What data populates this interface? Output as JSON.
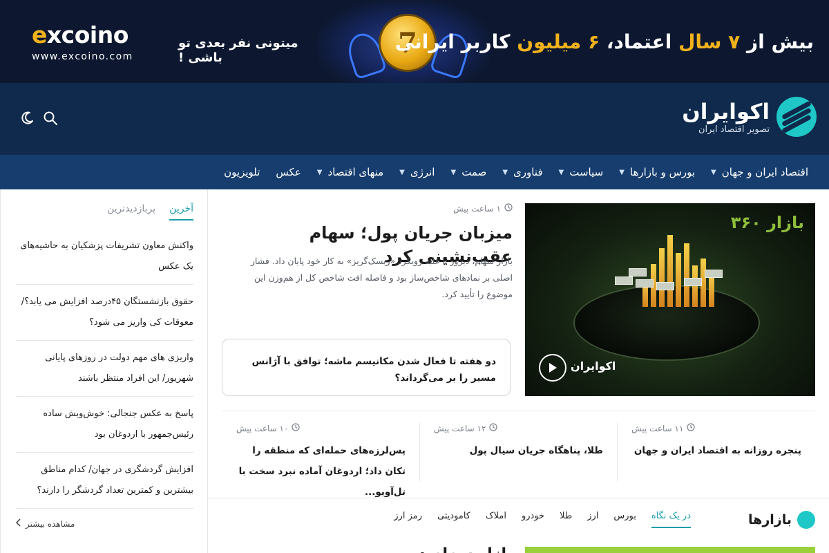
{
  "banner": {
    "brand_prefix": "e",
    "brand_rest": "xcoino",
    "url": "www.excoino.com",
    "subline": "میتونی نفر بعدی تو باشی !",
    "coin_value": "7",
    "headline_pre": "بیش از ",
    "headline_num1": "۷ سال",
    "headline_mid": " اعتماد، ",
    "headline_num2": "۶ میلیون",
    "headline_post": " کاربر ایرانی"
  },
  "header": {
    "site_name": "اکوایران",
    "site_tagline": "تصویر اقتصاد ایران",
    "search_icon": "search-icon",
    "theme_icon": "moon-icon"
  },
  "nav": {
    "items": [
      {
        "label": "اقتصاد ایران و جهان",
        "has_dropdown": true
      },
      {
        "label": "بورس و بازارها",
        "has_dropdown": true
      },
      {
        "label": "سیاست",
        "has_dropdown": true
      },
      {
        "label": "فناوری",
        "has_dropdown": true
      },
      {
        "label": "صمت",
        "has_dropdown": true
      },
      {
        "label": "انرژی",
        "has_dropdown": true
      },
      {
        "label": "منهای اقتصاد",
        "has_dropdown": true
      },
      {
        "label": "عکس",
        "has_dropdown": false
      },
      {
        "label": "تلویزیون",
        "has_dropdown": false
      }
    ]
  },
  "sidebar": {
    "tabs": [
      {
        "label": "آخرین",
        "active": true
      },
      {
        "label": "پربازدیدترین",
        "active": false
      }
    ],
    "items": [
      {
        "title": "واکنش معاون تشریفات پزشکیان به حاشیه‌های یک عکس"
      },
      {
        "title": "حقوق بازنشستگان ۴۵درصد افزایش می یابد؟/ معوقات کی واریز می شود؟"
      },
      {
        "title": "واریزی های مهم دولت در روزهای پایانی شهریور/ این افراد منتظر باشند"
      },
      {
        "title": "پاسخ به عکس جنجالی: خوش‌وبش ساده رئیس‌جمهور با اردوغان بود"
      },
      {
        "title": "افزایش گردشگری در جهان/ کدام مناطق بیشترین و کمترین تعداد گردشگر را دارند؟"
      }
    ],
    "more_label": "مشاهده بیشتر"
  },
  "feature": {
    "time": "۱ ساعت پیش",
    "title": "میزبان جریان پول؛ سهام عقب‌نشینی کرد",
    "description": "بازار سهام، دیروز با غلبه رویکرد «ریسک‌گریز» به کار خود پایان داد. فشار اصلی بر نمادهای شاخص‌ساز بود و فاصله افت شاخص کل از هم‌وزن این موضوع را تأیید کرد.",
    "image_watermark": "بازار ۳۶۰",
    "image_brand": "اکوایران",
    "play_icon": "play-icon"
  },
  "related": {
    "title": "دو هفته تا فعال شدن مکانیسم ماشه؛ توافق با آژانس مسیر را بر می‌گرداند؟"
  },
  "mini_news": [
    {
      "time": "۱۱ ساعت پیش",
      "title": "پنجره روزانه به اقتصاد ایران و جهان"
    },
    {
      "time": "۱۲ ساعت پیش",
      "title": "طلا، پناهگاه جریان سیال پول"
    },
    {
      "time": "۱۰ ساعت پیش",
      "title": "پس‌لرزه‌های حمله‌ای که منطقه را تکان داد؛ اردوغان آماده نبرد سخت با تل‌آویو..."
    }
  ],
  "markets": {
    "title": "بازارها",
    "tabs": [
      {
        "label": "در یک نگاه",
        "active": true
      },
      {
        "label": "بورس",
        "active": false
      },
      {
        "label": "ارز",
        "active": false
      },
      {
        "label": "طلا",
        "active": false
      },
      {
        "label": "خودرو",
        "active": false
      },
      {
        "label": "املاک",
        "active": false
      },
      {
        "label": "کامودیتی",
        "active": false
      },
      {
        "label": "رمز ارز",
        "active": false
      }
    ],
    "headline_partial": "بازار سهام در ..."
  },
  "colors": {
    "banner_bg": "#0d1830",
    "header_bg": "#0f2a4c",
    "nav_bg": "#163d6e",
    "accent": "#1b9ea9",
    "gold": "#f2b21b"
  }
}
